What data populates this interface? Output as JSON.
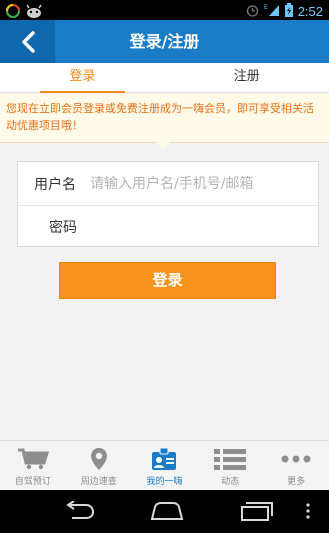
{
  "statusbar": {
    "time": "2:52",
    "network": "E"
  },
  "header": {
    "title": "登录/注册"
  },
  "tabs": [
    {
      "label": "登录",
      "active": true
    },
    {
      "label": "注册",
      "active": false
    }
  ],
  "notice": {
    "text": "您现在立即会员登录或免费注册成为一嗨会员，即可享受相关活动优惠项目哦！"
  },
  "form": {
    "username_label": "用户名",
    "username_placeholder": "请输入用户名/手机号/邮箱",
    "password_label": "密码"
  },
  "login_button": "登录",
  "bottom_nav": [
    {
      "label": "自驾预订",
      "icon": "cart-icon"
    },
    {
      "label": "周边速查",
      "icon": "location-pin-icon"
    },
    {
      "label": "我的一嗨",
      "icon": "member-card-icon",
      "active": true
    },
    {
      "label": "动态",
      "icon": "list-icon"
    },
    {
      "label": "更多",
      "icon": "more-dots-icon"
    }
  ],
  "colors": {
    "primary": "#1a7bc6",
    "accent": "#f7941d",
    "notice_text": "#e8701a"
  }
}
